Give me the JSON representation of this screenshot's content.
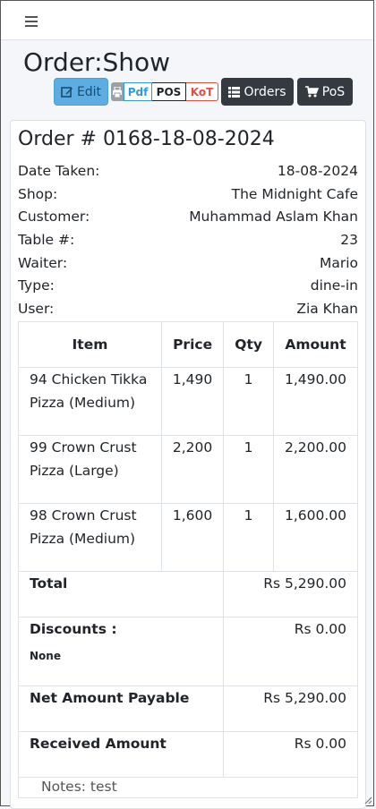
{
  "page": {
    "title": "Order:Show"
  },
  "toolbar": {
    "edit_label": "Edit",
    "pdf_label": "Pdf",
    "pos_print_label": "POS",
    "kot_label": "KoT",
    "orders_label": "Orders",
    "pos_label": "PoS"
  },
  "order": {
    "title": "Order # 0168-18-08-2024",
    "info": [
      {
        "label": "Date Taken:",
        "value": "18-08-2024"
      },
      {
        "label": "Shop:",
        "value": "The Midnight Cafe"
      },
      {
        "label": "Customer:",
        "value": "Muhammad Aslam Khan"
      },
      {
        "label": "Table #:",
        "value": "23"
      },
      {
        "label": "Waiter:",
        "value": "Mario"
      },
      {
        "label": "Type:",
        "value": "dine-in"
      },
      {
        "label": "User:",
        "value": "Zia Khan"
      }
    ],
    "table_headers": {
      "item": "Item",
      "price": "Price",
      "qty": "Qty",
      "amount": "Amount"
    },
    "items": [
      {
        "name": "94 Chicken Tikka Pizza (Medium)",
        "price": "1,490",
        "qty": "1",
        "amount": "1,490.00"
      },
      {
        "name": "99 Crown Crust Pizza (Large)",
        "price": "2,200",
        "qty": "1",
        "amount": "2,200.00"
      },
      {
        "name": "98 Crown Crust Pizza (Medium)",
        "price": "1,600",
        "qty": "1",
        "amount": "1,600.00"
      }
    ],
    "summary": {
      "total_label": "Total",
      "total_value": "Rs 5,290.00",
      "discounts_label": "Discounts :",
      "discounts_note": "None",
      "discounts_value": "Rs 0.00",
      "net_label": "Net Amount Payable",
      "net_value": "Rs 5,290.00",
      "received_label": "Received Amount",
      "received_value": "Rs 0.00"
    },
    "notes": "Notes: test"
  },
  "colors": {
    "edit": "#5dade2",
    "dark": "#343a40",
    "pdf": "#3498db",
    "kot": "#e74c3c"
  }
}
